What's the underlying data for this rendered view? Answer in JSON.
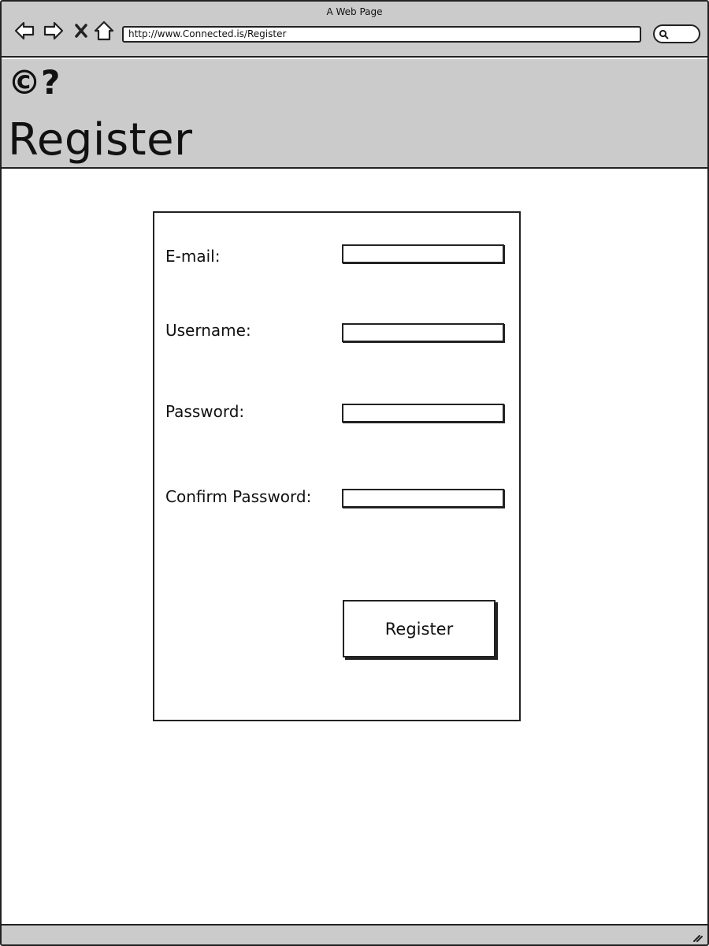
{
  "browser": {
    "title": "A Web Page",
    "url": "http://www.Connected.is/Register",
    "icons": {
      "back": "arrow-left-icon",
      "forward": "arrow-right-icon",
      "stop": "close-icon",
      "home": "home-icon",
      "search": "search-icon",
      "resize": "resize-grip-icon"
    }
  },
  "header": {
    "logo_text": "©?",
    "page_title": "Register"
  },
  "form": {
    "email_label": "E-mail:",
    "email_value": "",
    "username_label": "Username:",
    "username_value": "",
    "password_label": "Password:",
    "password_value": "",
    "confirm_password_label": "Confirm Password:",
    "confirm_password_value": "",
    "submit_label": "Register"
  },
  "colors": {
    "chrome_bg": "#cbcbcb",
    "outline": "#222222",
    "page_bg": "#ffffff"
  }
}
